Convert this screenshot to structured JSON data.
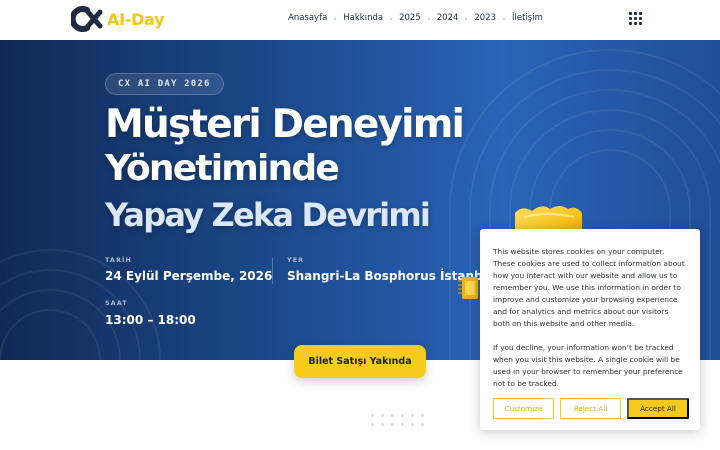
{
  "brand": {
    "name": "AI-Day",
    "accent": "#f6cb1c",
    "dark": "#1f2a44"
  },
  "nav": {
    "items": [
      {
        "label": "Anasayfa"
      },
      {
        "label": "Hakkında"
      },
      {
        "label": "2025"
      },
      {
        "label": "2024"
      },
      {
        "label": "2023"
      },
      {
        "label": "İletişim"
      }
    ],
    "menu_icon": "grid-menu-icon"
  },
  "hero": {
    "badge": "CX AI DAY 2026",
    "title_line1": "Müşteri Deneyimi",
    "title_line2": "Yönetiminde",
    "title_line3": "Yapay Zeka Devrimi",
    "date_label": "TARİH",
    "date_value": "24 Eylül Perşembe, 2026",
    "venue_label": "YER",
    "venue_value": "Shangri-La Bosphorus İstanbul",
    "time_label": "SAAT",
    "time_value": "13:00 – 18:00",
    "cta_label": "Bilet Satışı Yakında"
  },
  "cookie": {
    "text1": "This website stores cookies on your computer. These cookies are used to collect information about how you interact with our website and allow us to remember you. We use this information in order to improve and customize your browsing experience and for analytics and metrics about our visitors both on this website and other media.",
    "text2": "If you decline, your information won’t be tracked when you visit this website. A single cookie will be used in your browser to remember your preference not to be tracked.",
    "customize_label": "Customize",
    "reject_label": "Reject All",
    "accept_label": "Accept All"
  }
}
